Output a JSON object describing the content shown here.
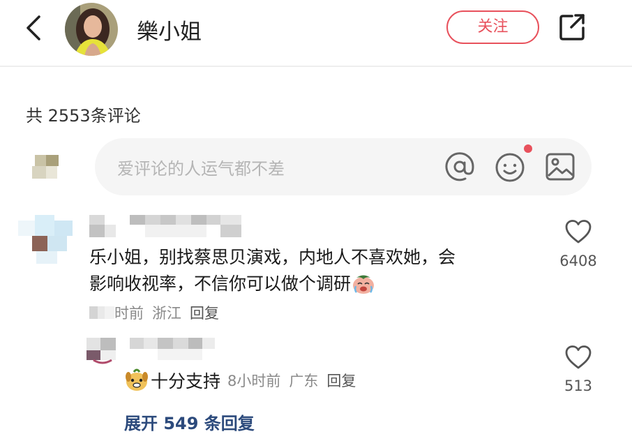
{
  "header": {
    "username": "樂小姐",
    "follow_label": "关注"
  },
  "comments_header": {
    "count_text": "共 2553条评论"
  },
  "input": {
    "placeholder": "爱评论的人运气都不差"
  },
  "comments": [
    {
      "text_line1": "乐小姐，别找蔡思贝演戏，内地人不喜欢她，会",
      "text_line2": "影响收视率，不信你可以做个调研",
      "time": "时前",
      "location": "浙江",
      "reply_label": "回复",
      "likes": "6408"
    }
  ],
  "reply": {
    "text": "十分支持",
    "time": "8小时前",
    "location": "广东",
    "reply_label": "回复",
    "likes": "513"
  },
  "expand_label": "展开 549 条回复",
  "colors": {
    "accent": "#e8515c",
    "link": "#2c4a7c",
    "muted": "#8a8a8a"
  }
}
